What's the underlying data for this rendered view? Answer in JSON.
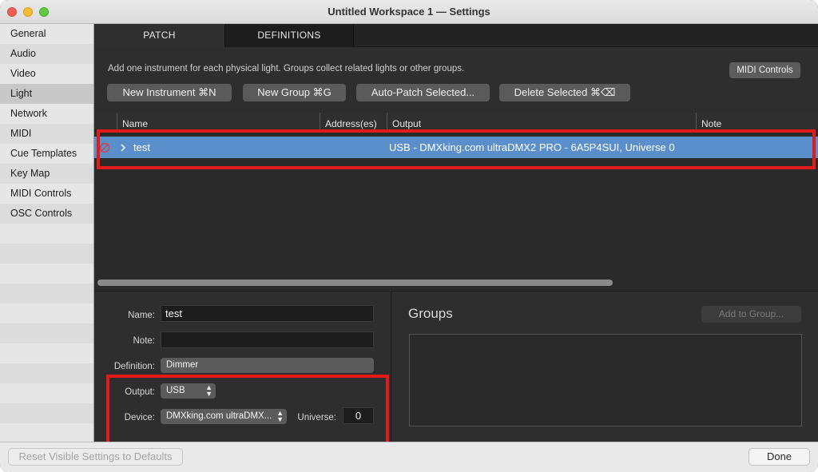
{
  "window": {
    "title": "Untitled Workspace 1 — Settings"
  },
  "sidebar": {
    "items": [
      {
        "label": "General"
      },
      {
        "label": "Audio"
      },
      {
        "label": "Video"
      },
      {
        "label": "Light",
        "active": true
      },
      {
        "label": "Network"
      },
      {
        "label": "MIDI"
      },
      {
        "label": "Cue Templates"
      },
      {
        "label": "Key Map"
      },
      {
        "label": "MIDI Controls"
      },
      {
        "label": "OSC Controls"
      }
    ]
  },
  "tabs": {
    "patch": "PATCH",
    "definitions": "DEFINITIONS"
  },
  "info_text": "Add one instrument for each physical light.  Groups collect related lights or other groups.",
  "midi_controls_button": "MIDI Controls",
  "toolbar": {
    "new_instrument": "New Instrument  ⌘N",
    "new_group": "New Group  ⌘G",
    "auto_patch": "Auto-Patch Selected...",
    "delete_selected": "Delete Selected  ⌘⌫"
  },
  "table": {
    "columns": {
      "name": "Name",
      "address": "Address(es)",
      "output": "Output",
      "note": "Note"
    },
    "rows": [
      {
        "status_icon": "no-entry-icon",
        "name": "test",
        "address": "",
        "output": "USB - DMXking.com ultraDMX2 PRO - 6A5P4SUI, Universe 0",
        "note": ""
      }
    ]
  },
  "inspector": {
    "name_label": "Name:",
    "name_value": "test",
    "note_label": "Note:",
    "note_value": "",
    "definition_label": "Definition:",
    "definition_value": "Dimmer",
    "output_label": "Output:",
    "output_value": "USB",
    "device_label": "Device:",
    "device_value": "DMXking.com ultraDMX...",
    "universe_label": "Universe:",
    "universe_value": "0"
  },
  "groups": {
    "title": "Groups",
    "add_button": "Add to Group..."
  },
  "footer": {
    "reset_button": "Reset Visible Settings to Defaults",
    "done_button": "Done"
  },
  "colors": {
    "selection": "#5b8fcb",
    "highlight_box": "#e21a1a"
  }
}
